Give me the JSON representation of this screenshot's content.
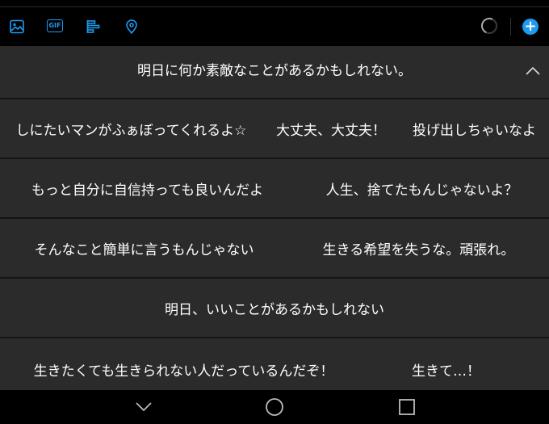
{
  "toolbar": {
    "icons": [
      "image-icon",
      "gif-icon",
      "poll-icon",
      "location-icon"
    ],
    "gif_label": "GIF",
    "add_label": "+",
    "accent": "#1d9bf0"
  },
  "suggestions": [
    {
      "items": [
        "明日に何か素敵なことがあるかもしれない。"
      ]
    },
    {
      "items": [
        "しにたいマンがふぁぼってくれるよ☆",
        "大丈夫、大丈夫！",
        "投げ出しちゃいなよ"
      ]
    },
    {
      "items": [
        "もっと自分に自信持っても良いんだよ",
        "人生、捨てたもんじゃないよ？"
      ]
    },
    {
      "items": [
        "そんなこと簡単に言うもんじゃない",
        "生きる希望を失うな。頑張れ。"
      ]
    },
    {
      "items": [
        "明日、いいことがあるかもしれない"
      ]
    },
    {
      "items": [
        "生きたくても生きられない人だっているんだぞ！",
        "生きて…！"
      ]
    }
  ],
  "navbar": {
    "buttons": [
      "back-chevron-icon",
      "home-circle-icon",
      "recents-square-icon"
    ]
  }
}
